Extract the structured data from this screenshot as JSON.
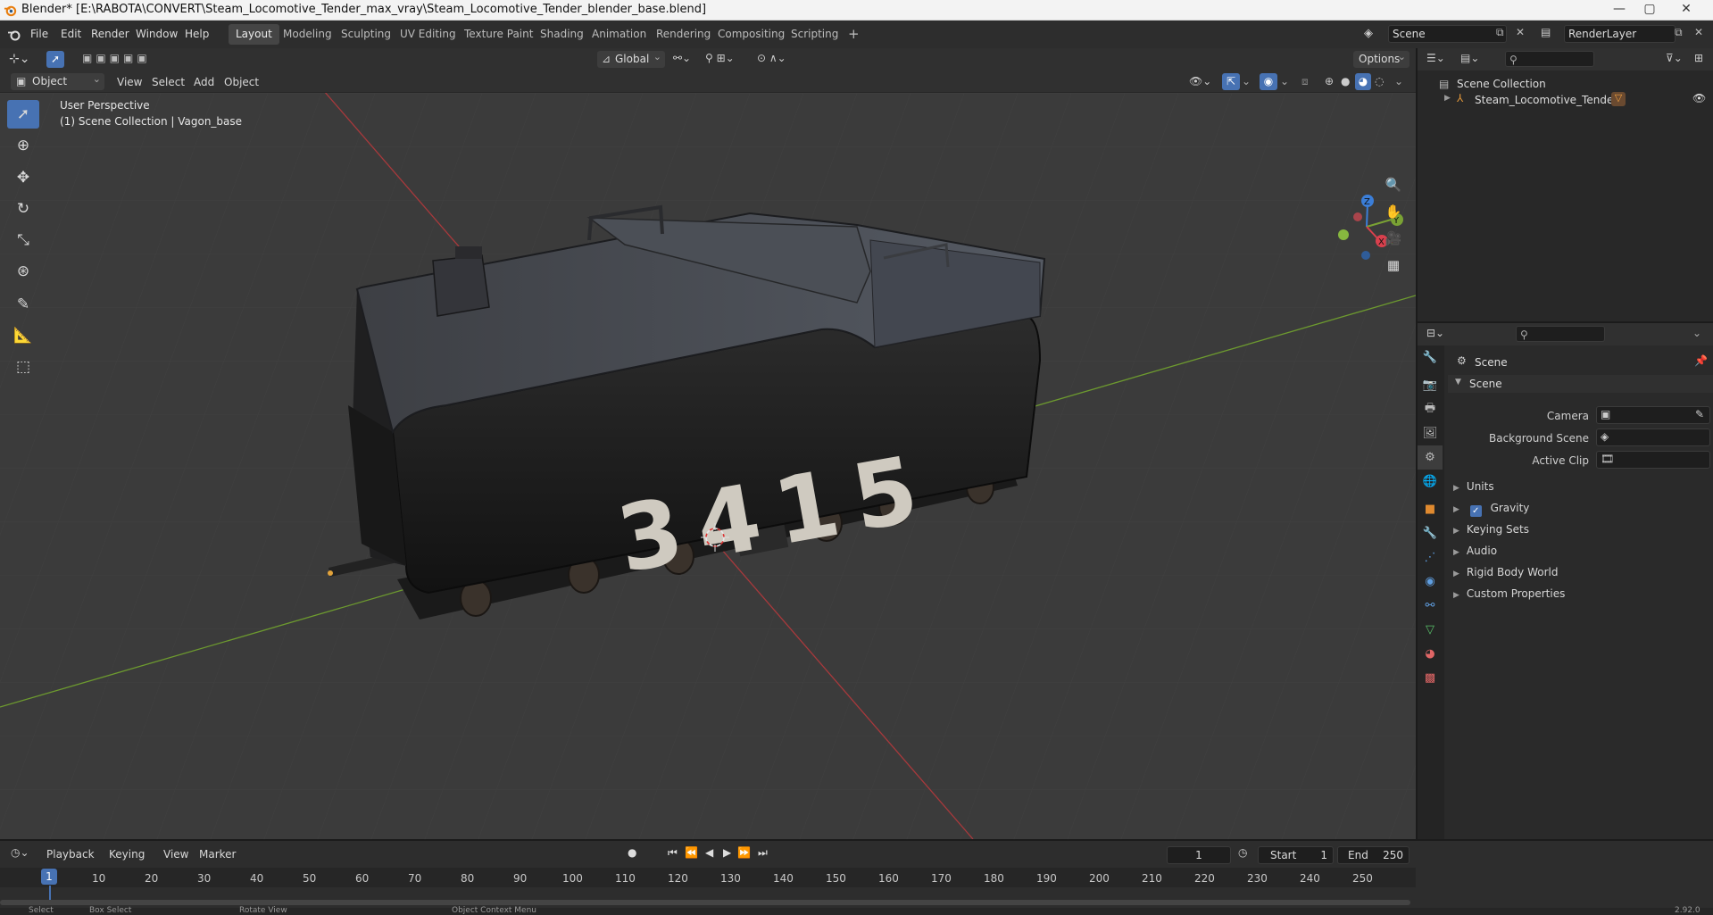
{
  "window": {
    "title": "Blender* [E:\\RABOTA\\CONVERT\\Steam_Locomotive_Tender_max_vray\\Steam_Locomotive_Tender_blender_base.blend]",
    "minimize": "—",
    "maximize": "▢",
    "close": "✕"
  },
  "menu": [
    "File",
    "Edit",
    "Render",
    "Window",
    "Help"
  ],
  "workspaces": [
    "Layout",
    "Modeling",
    "Sculpting",
    "UV Editing",
    "Texture Paint",
    "Shading",
    "Animation",
    "Rendering",
    "Compositing",
    "Scripting"
  ],
  "active_workspace": "Layout",
  "scene_field": "Scene",
  "renderlayer_field": "RenderLayer",
  "viewport_header": {
    "orientation": "Global",
    "options": "Options"
  },
  "viewport_toolbar": {
    "mode": "Object Mode",
    "menus": [
      "View",
      "Select",
      "Add",
      "Object"
    ]
  },
  "viewport": {
    "perspective": "User Perspective",
    "collection": "(1) Scene Collection | Vagon_base",
    "model_number": "3415",
    "gizmo_axes": [
      "Z",
      "Y",
      "X"
    ]
  },
  "outliner": {
    "root": "Scene Collection",
    "items": [
      {
        "label": "Steam_Locomotive_Tender"
      }
    ]
  },
  "properties": {
    "context": "Scene",
    "panel_title": "Scene",
    "fields": [
      {
        "label": "Camera"
      },
      {
        "label": "Background Scene"
      },
      {
        "label": "Active Clip"
      }
    ],
    "sections": [
      "Units",
      "Gravity",
      "Keying Sets",
      "Audio",
      "Rigid Body World",
      "Custom Properties"
    ]
  },
  "timeline": {
    "menus": [
      "Playback",
      "Keying",
      "View",
      "Marker"
    ],
    "current_frame": "1",
    "start_label": "Start",
    "start": "1",
    "end_label": "End",
    "end": "250",
    "ruler": [
      "1",
      "10",
      "20",
      "30",
      "40",
      "50",
      "60",
      "70",
      "80",
      "90",
      "100",
      "110",
      "120",
      "130",
      "140",
      "150",
      "160",
      "170",
      "180",
      "190",
      "200",
      "210",
      "220",
      "230",
      "240",
      "250"
    ]
  },
  "statusbar": {
    "items": [
      "Select",
      "Box Select",
      "Rotate View",
      "Object Context Menu"
    ],
    "version": "2.92.0"
  }
}
